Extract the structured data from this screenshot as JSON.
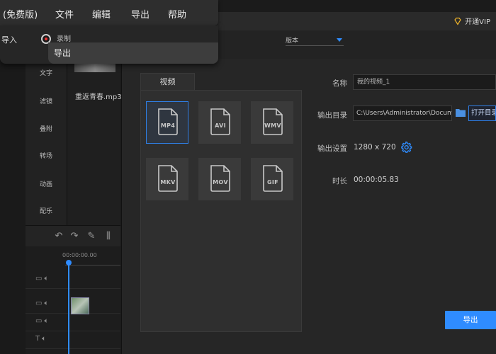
{
  "menubar": {
    "app_mode": "(免费版)",
    "items": [
      "文件",
      "编辑",
      "导出",
      "帮助"
    ]
  },
  "toolbar": {
    "import_label": "导入",
    "record_label": "录制",
    "dropdown_item": "导出",
    "vip_label": "开通VIP",
    "top_select_value": "版本"
  },
  "sidebar": {
    "items": [
      "文字",
      "滤镜",
      "叠附",
      "转场",
      "动画",
      "配乐"
    ]
  },
  "media": {
    "file_name": "重返青春.mp3"
  },
  "timeline": {
    "timecode": "00:00:00.00"
  },
  "export_dialog": {
    "tab_label": "视频",
    "formats": [
      "MP4",
      "AVI",
      "WMV",
      "MKV",
      "MOV",
      "GIF"
    ],
    "selected_format": "MP4",
    "name_label": "名称",
    "name_value": "我的视频_1",
    "output_dir_label": "输出目录",
    "output_dir_value": "C:\\Users\\Administrator\\Documents",
    "open_dir_button": "打开目录",
    "output_settings_label": "输出设置",
    "resolution": "1280 x 720",
    "duration_label": "时长",
    "duration_value": "00:00:05.83",
    "export_button": "导出"
  },
  "colors": {
    "accent": "#2f8cff",
    "background": "#1b1b1b",
    "dialog": "#262626"
  }
}
